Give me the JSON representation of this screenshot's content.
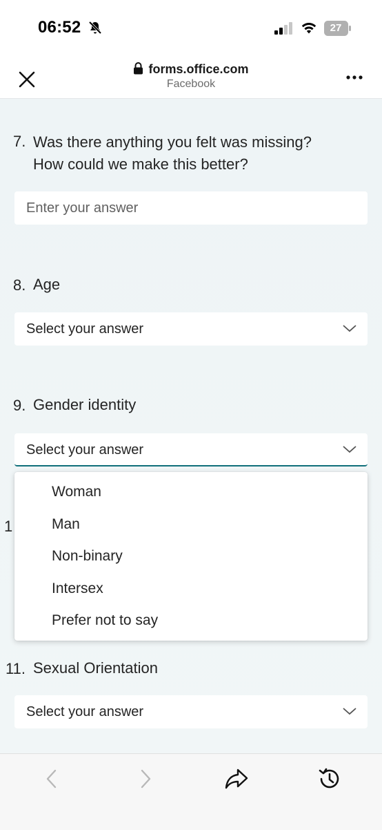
{
  "status_bar": {
    "time": "06:52",
    "battery": "27"
  },
  "browser": {
    "url": "forms.office.com",
    "subtitle": "Facebook"
  },
  "questions": [
    {
      "number": "7.",
      "line1": "Was there anything you felt was missing?",
      "line2": "How could we make this better?",
      "placeholder": "Enter your answer"
    },
    {
      "number": "8.",
      "title": "Age",
      "select": "Select your answer"
    },
    {
      "number": "9.",
      "title": "Gender identity",
      "select": "Select your answer"
    },
    {
      "number_partial": "1",
      "hidden_note": ""
    },
    {
      "number": "11.",
      "title": "Sexual Orientation",
      "select": "Select your answer"
    }
  ],
  "dropdown_options": [
    "Woman",
    "Man",
    "Non-binary",
    "Intersex",
    "Prefer not to say"
  ],
  "colors": {
    "accent": "#0f6f7a",
    "background": "#eef4f6"
  },
  "toolbar": {
    "icons": [
      "back-icon",
      "forward-icon",
      "share-icon",
      "history-icon"
    ]
  }
}
